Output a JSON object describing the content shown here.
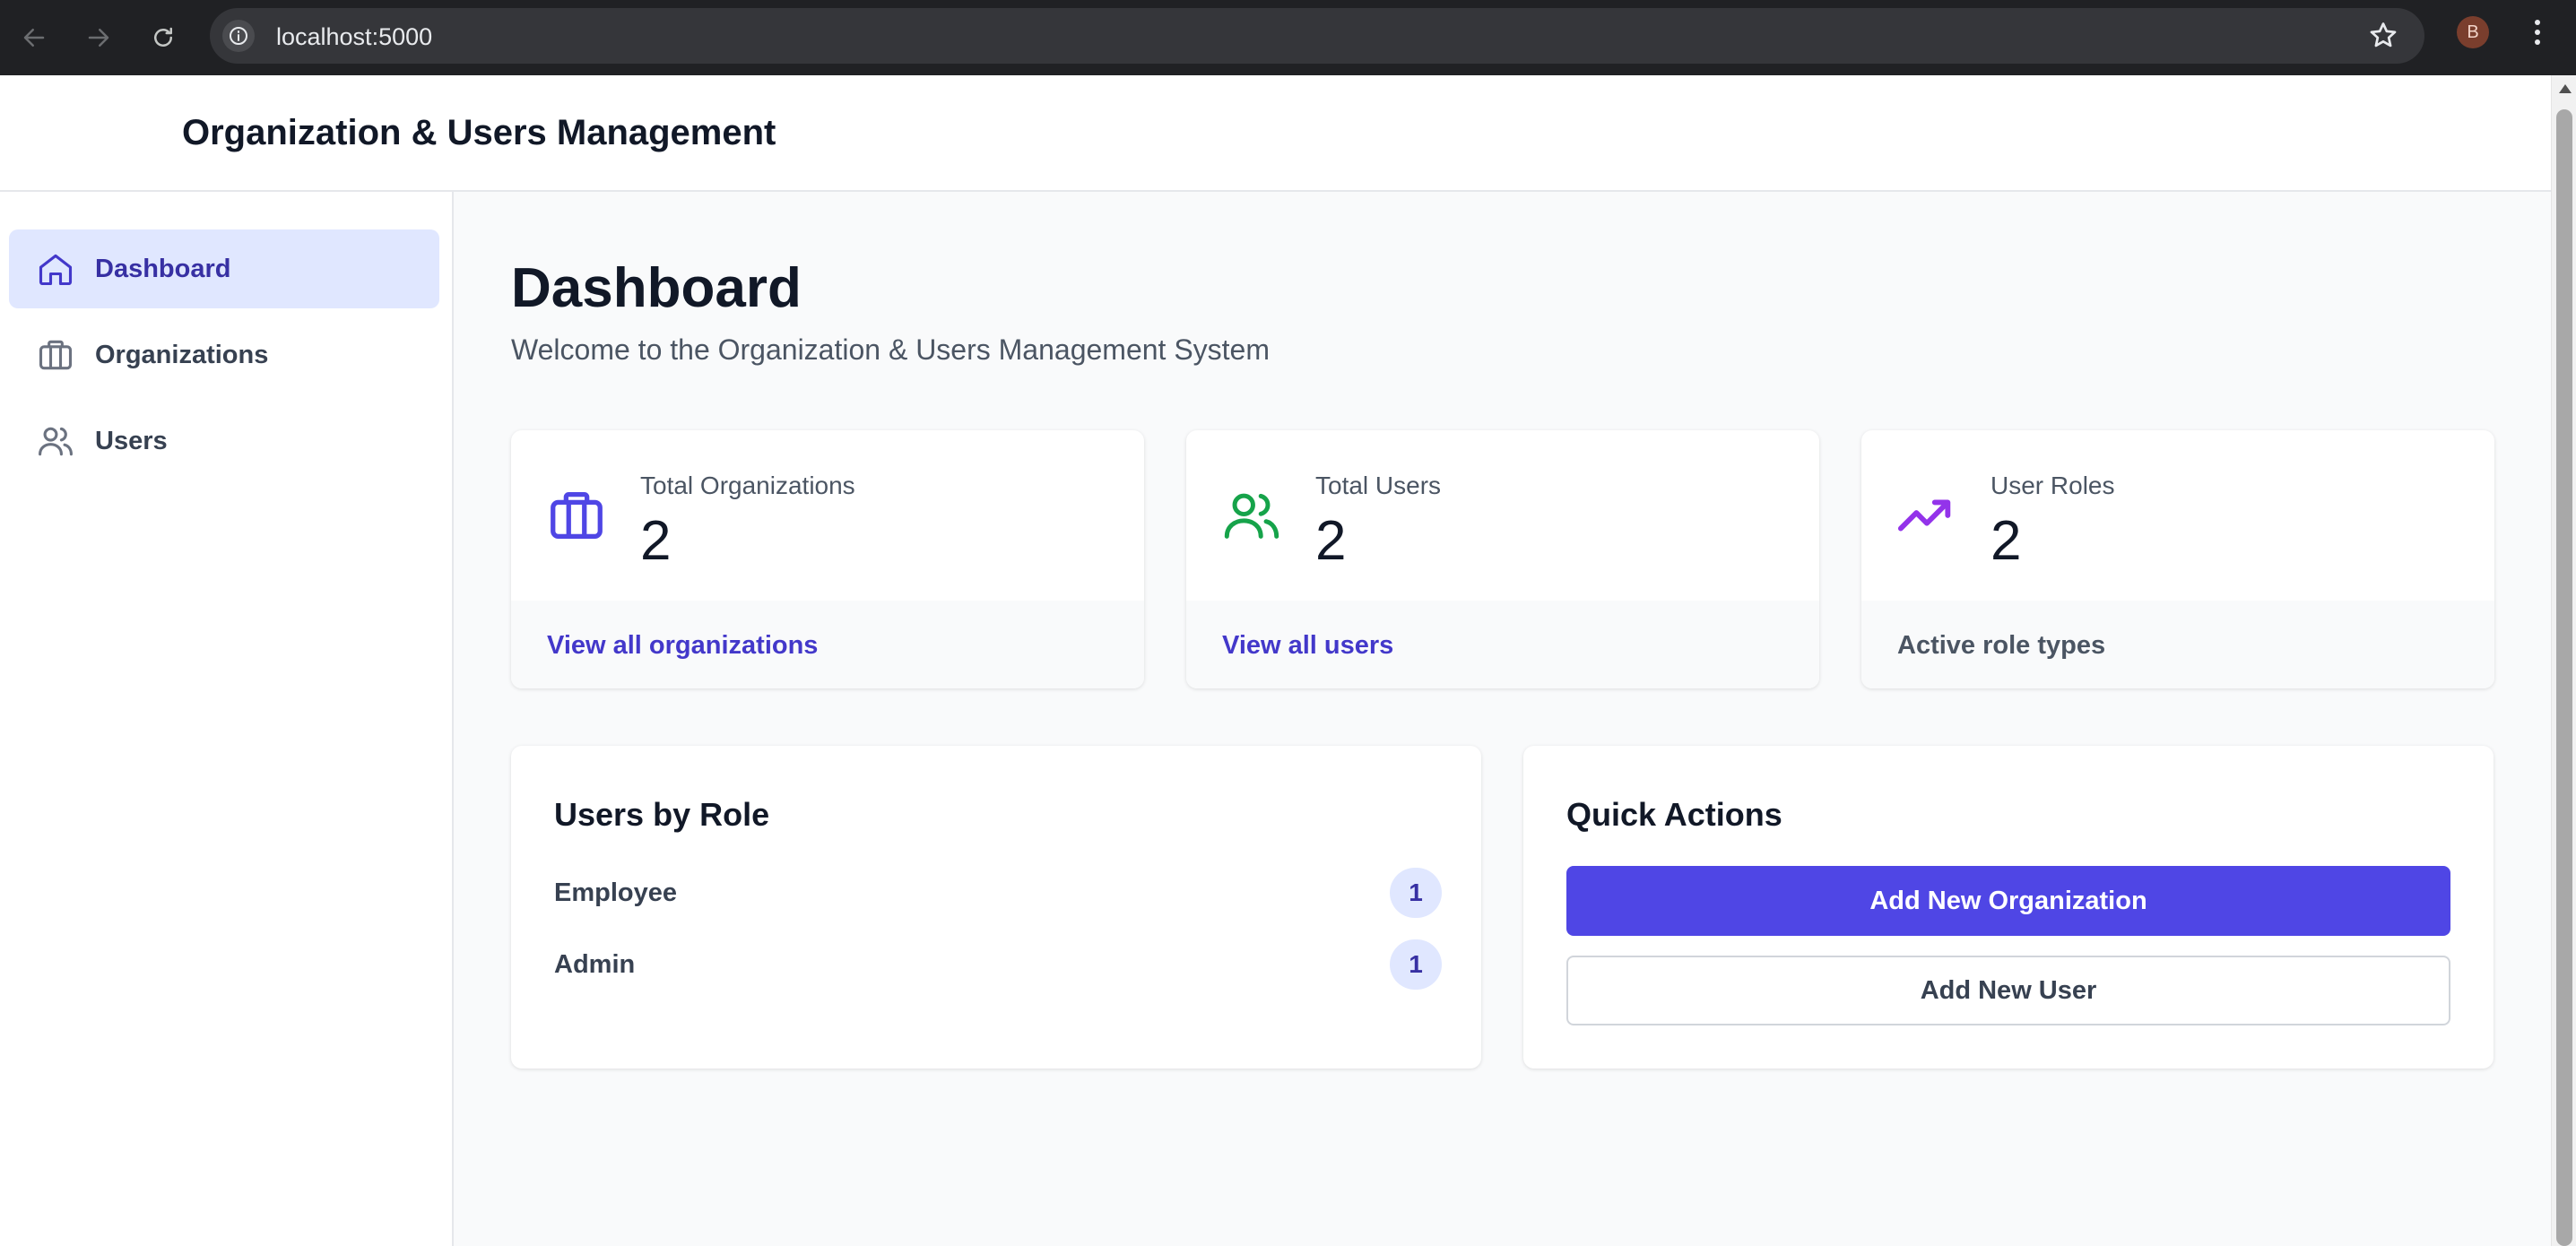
{
  "browser": {
    "url": "localhost:5000",
    "profile_initial": "B",
    "icons": [
      "back-arrow-icon",
      "forward-arrow-icon",
      "reload-icon",
      "site-info-icon",
      "bookmark-star-icon",
      "browser-menu-icon"
    ]
  },
  "app": {
    "title": "Organization & Users Management"
  },
  "sidebar": {
    "items": [
      {
        "label": "Dashboard",
        "icon": "home-icon",
        "active": true
      },
      {
        "label": "Organizations",
        "icon": "briefcase-icon",
        "active": false
      },
      {
        "label": "Users",
        "icon": "users-icon",
        "active": false
      }
    ]
  },
  "main": {
    "title": "Dashboard",
    "subtitle": "Welcome to the Organization & Users Management System",
    "stats": [
      {
        "label": "Total Organizations",
        "value": "2",
        "footer": "View all organizations",
        "icon": "briefcase-icon",
        "color": "#4f46e5"
      },
      {
        "label": "Total Users",
        "value": "2",
        "footer": "View all users",
        "icon": "users-icon",
        "color": "#16a34a"
      },
      {
        "label": "User Roles",
        "value": "2",
        "footer": "Active role types",
        "icon": "trending-up-icon",
        "color": "#9333ea"
      }
    ],
    "users_by_role": {
      "title": "Users by Role",
      "roles": [
        {
          "name": "Employee",
          "count": "1"
        },
        {
          "name": "Admin",
          "count": "1"
        }
      ]
    },
    "quick_actions": {
      "title": "Quick Actions",
      "add_org_label": "Add New Organization",
      "add_user_label": "Add New User"
    }
  },
  "colors": {
    "accent": "#4f46e5",
    "active_nav_bg": "#e0e7ff",
    "users_icon": "#16a34a",
    "roles_icon": "#9333ea"
  }
}
